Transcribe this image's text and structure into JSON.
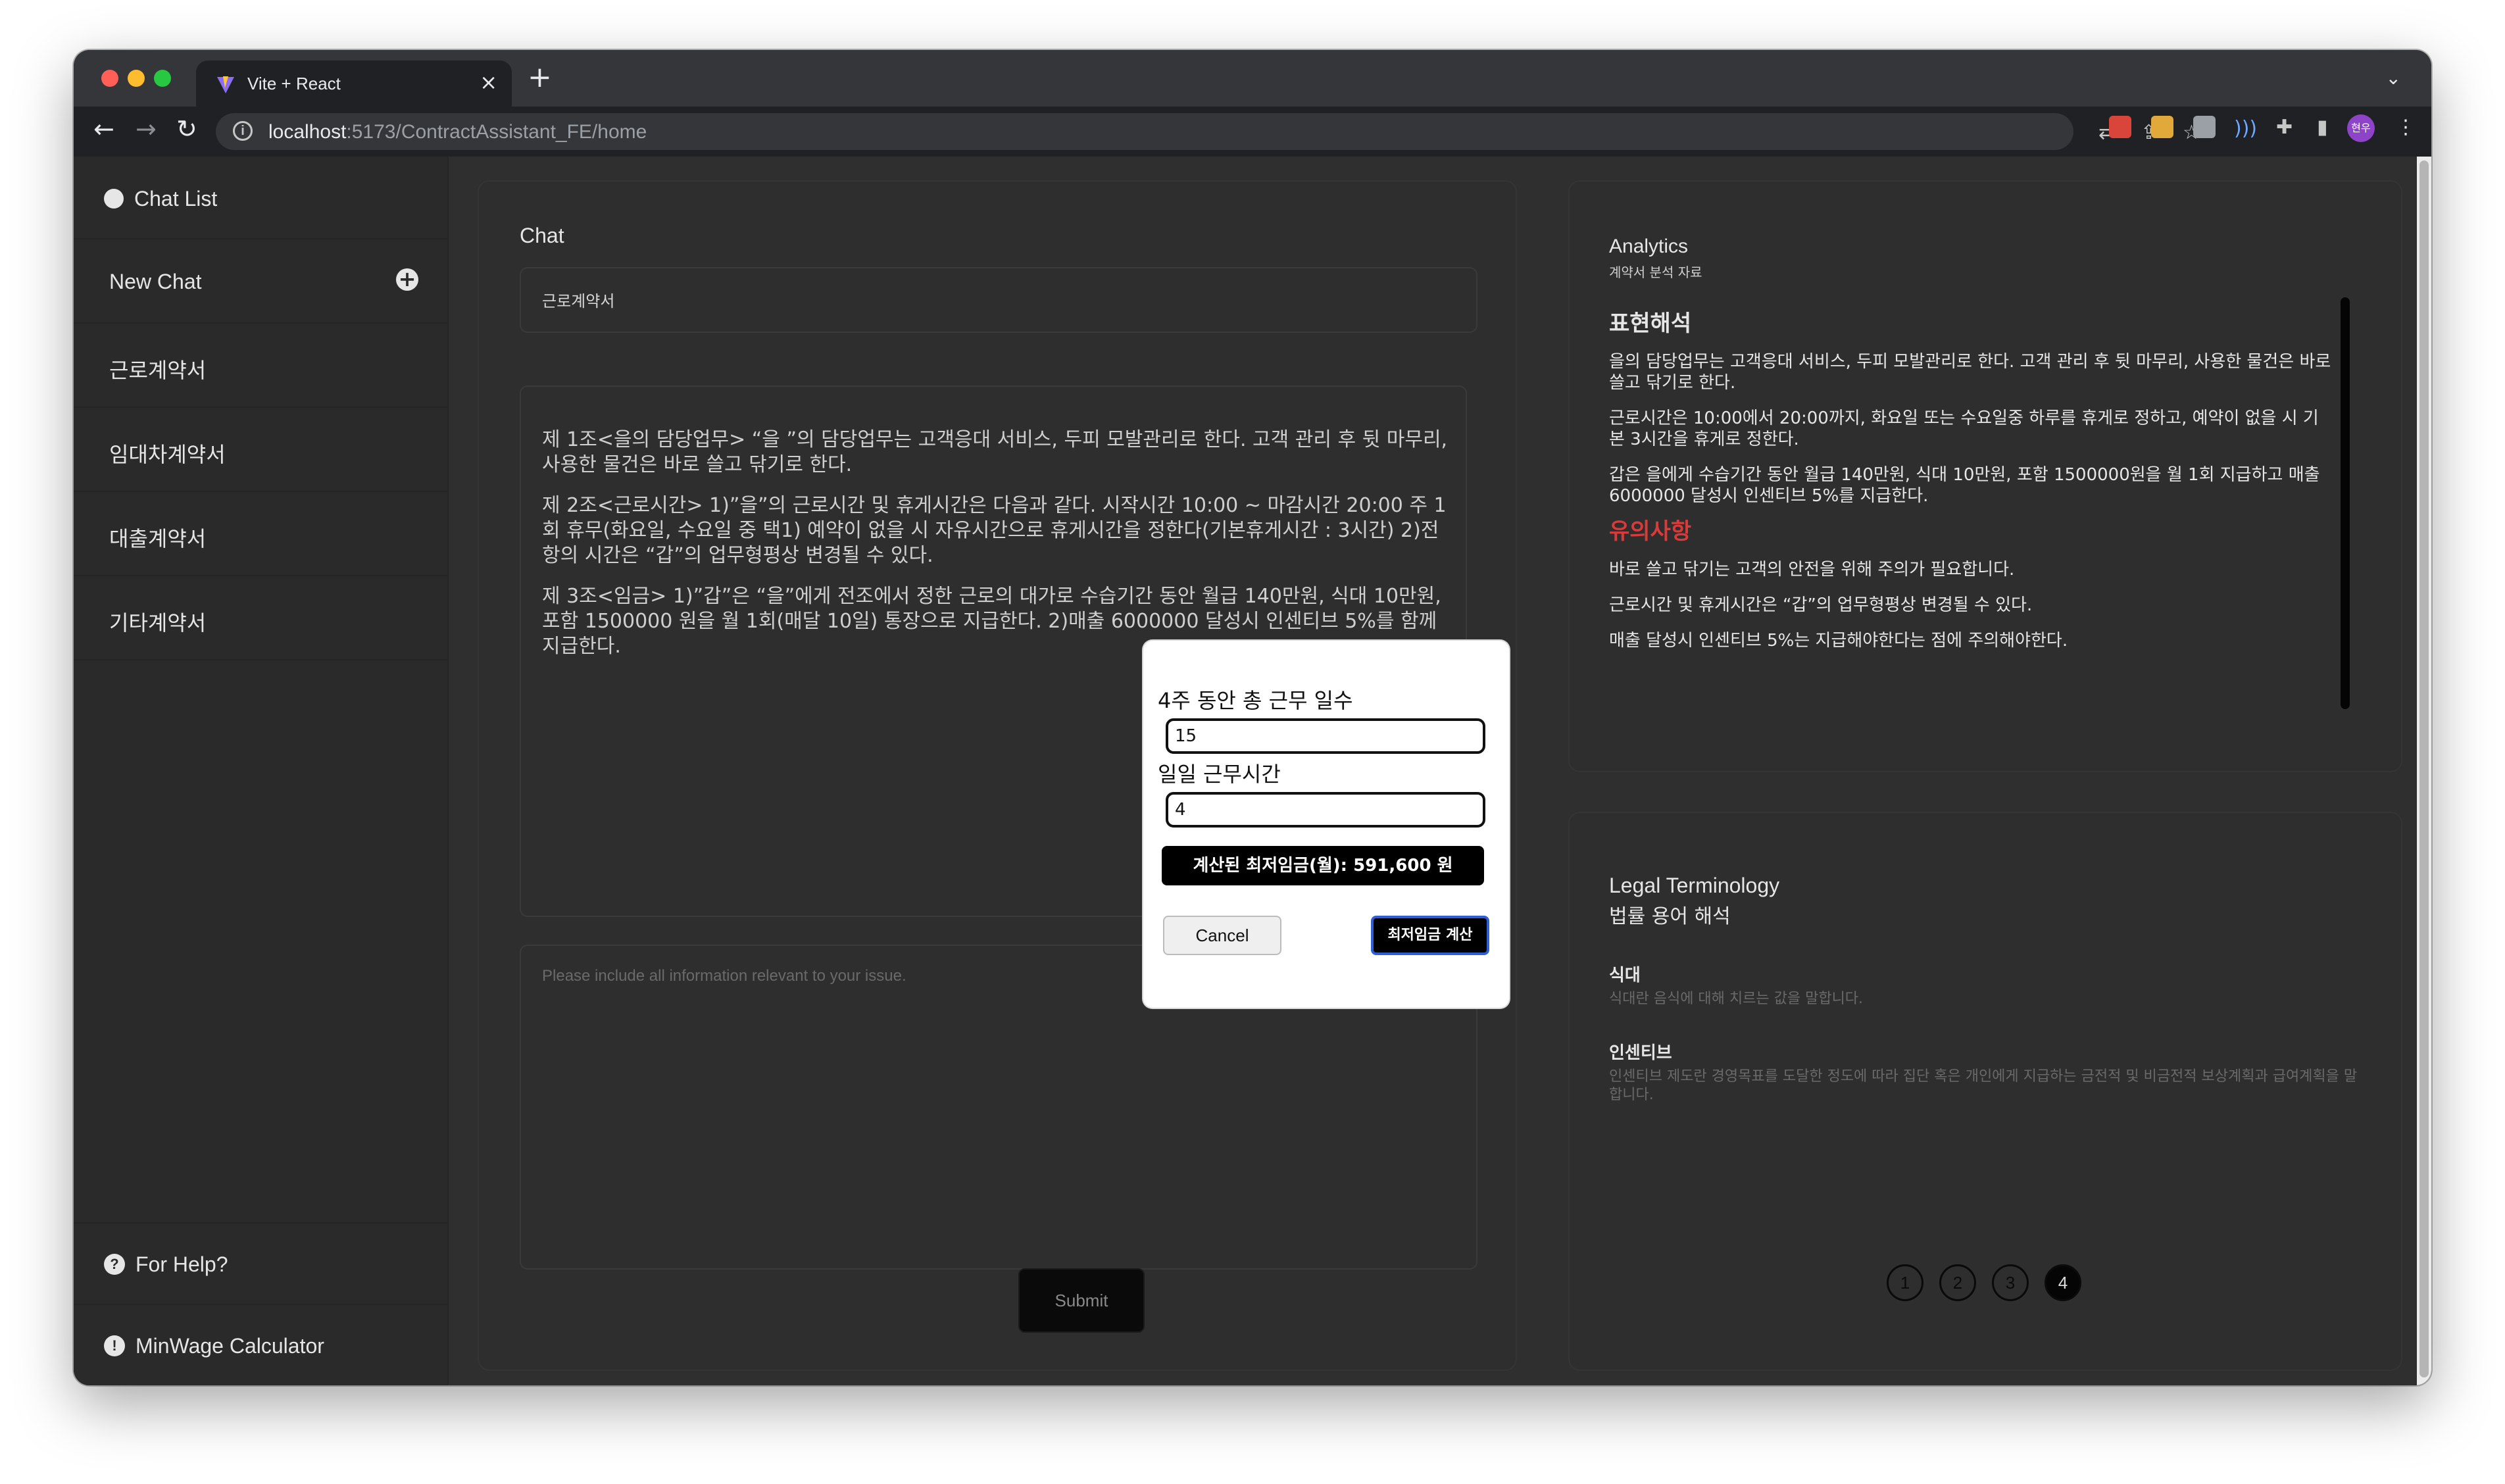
{
  "browser": {
    "tab_title": "Vite + React",
    "tab_close": "×",
    "new_tab": "+",
    "tab_list": "⌄",
    "url_host": "localhost",
    "url_rest": ":5173/ContractAssistant_FE/home",
    "profile_initials": "현우",
    "colors": {
      "close": "#ff5f57",
      "minimize": "#febc2e",
      "maximize": "#28c840"
    }
  },
  "sidebar": {
    "header": "Chat List",
    "new_chat": "New Chat",
    "items": [
      {
        "label": "근로계약서"
      },
      {
        "label": "임대차계약서"
      },
      {
        "label": "대출계약서"
      },
      {
        "label": "기타계약서"
      }
    ],
    "help": "For Help?",
    "calculator": "MinWage Calculator"
  },
  "chat": {
    "title": "Chat",
    "contract_type": "근로계약서",
    "paragraphs": [
      "제 1조<을의 담당업무> “을 ”의 담당업무는 고객응대 서비스, 두피 모발관리로 한다. 고객 관리 후 뒷 마무리, 사용한 물건은 바로 쓸고 닦기로 한다.",
      "제 2조<근로시간> 1)”을”의 근로시간 및 휴게시간은 다음과 같다. 시작시간 10:00 ~ 마감시간 20:00 주 1회 휴무(화요일, 수요일 중 택1) 예약이 없을 시 자유시간으로 휴게시간을 정한다(기본휴게시간 : 3시간) 2)전항의 시간은 “갑”의 업무형평상 변경될 수 있다.",
      "제 3조<임금> 1)”갑”은 “을”에게 전조에서 정한 근로의 대가로 수습기간 동안 월급 140만원, 식대 10만원, 포함 1500000 원을 월 1회(매달 10일) 통장으로 지급한다. 2)매출 6000000 달성시 인센티브 5%를 함께 지급한다."
    ],
    "placeholder": "Please include all information relevant to your issue.",
    "submit": "Submit"
  },
  "analytics": {
    "title": "Analytics",
    "subtitle": "계약서 분석 자료",
    "section1_title": "표현해석",
    "section1_items": [
      "을의 담당업무는 고객응대 서비스, 두피 모발관리로 한다. 고객 관리 후 뒷 마무리, 사용한 물건은 바로 쓸고 닦기로 한다.",
      "근로시간은 10:00에서 20:00까지, 화요일 또는 수요일중 하루를 휴게로 정하고, 예약이 없을 시 기본 3시간을 휴게로 정한다.",
      "갑은 을에게 수습기간 동안 월급 140만원, 식대 10만원, 포함 1500000원을 월 1회 지급하고 매출 6000000 달성시 인센티브 5%를 지급한다."
    ],
    "section2_title": "유의사항",
    "section2_items": [
      "바로 쓸고 닦기는 고객의 안전을 위해 주의가 필요합니다.",
      "근로시간 및 휴게시간은 “갑”의 업무형평상 변경될 수 있다.",
      "매출 달성시 인센티브 5%는 지급해야한다는 점에 주의해야한다."
    ],
    "warn_color": "#d93b3b"
  },
  "legal": {
    "title": "Legal Terminology",
    "subtitle": "법률 용어 해석",
    "terms": [
      {
        "term": "식대",
        "definition": "식대란 음식에 대해 치르는 값을 말합니다."
      },
      {
        "term": "인센티브",
        "definition": "인센티브 제도란 경영목표를 도달한 정도에 따라 집단 혹은 개인에게 지급하는 금전적 및 비금전적 보상계획과 급여계획을 말합니다."
      }
    ],
    "pages": [
      "1",
      "2",
      "3",
      "4"
    ],
    "active_page": "4"
  },
  "modal": {
    "days_label": "4주 동안 총 근무 일수",
    "days_value": "15",
    "hours_label": "일일 근무시간",
    "hours_value": "4",
    "result": "계산된 최저임금(월): 591,600 원",
    "cancel": "Cancel",
    "calculate": "최저임금 계산"
  }
}
